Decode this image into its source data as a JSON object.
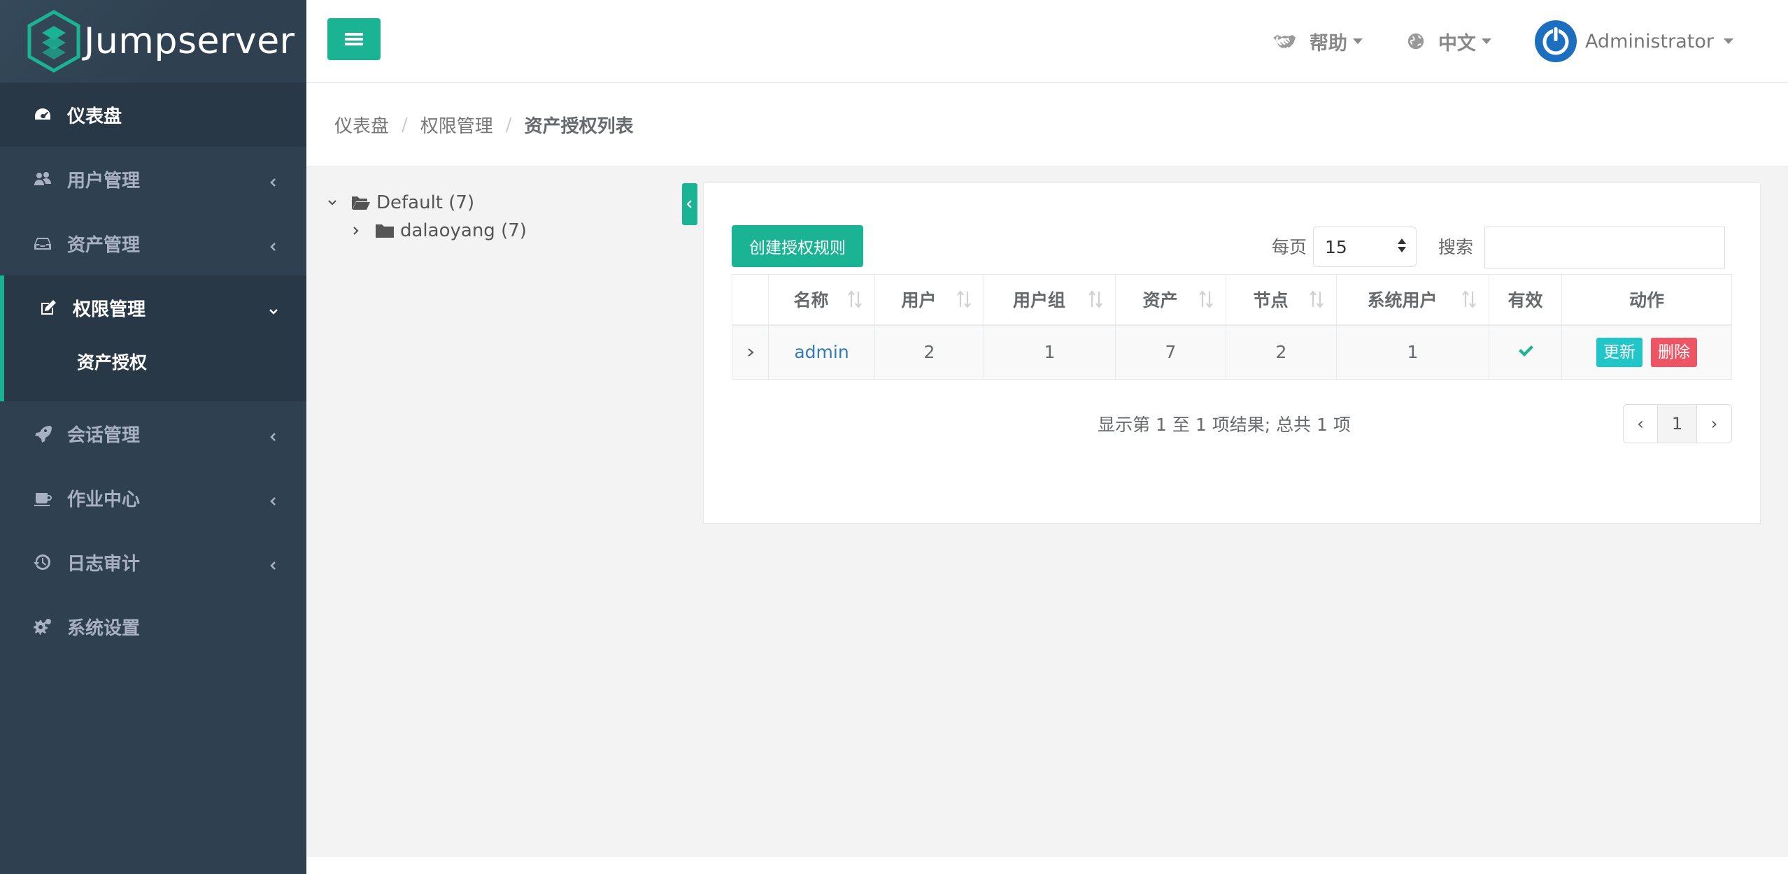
{
  "app": {
    "name": "Jumpserver"
  },
  "sidebar": {
    "items": [
      {
        "label": "仪表盘",
        "icon": "dashboard-icon"
      },
      {
        "label": "用户管理",
        "icon": "users-icon"
      },
      {
        "label": "资产管理",
        "icon": "inbox-icon"
      },
      {
        "label": "权限管理",
        "icon": "edit-icon",
        "sub": [
          "资产授权"
        ]
      },
      {
        "label": "会话管理",
        "icon": "rocket-icon"
      },
      {
        "label": "作业中心",
        "icon": "coffee-icon"
      },
      {
        "label": "日志审计",
        "icon": "history-icon"
      },
      {
        "label": "系统设置",
        "icon": "gears-icon"
      }
    ]
  },
  "topbar": {
    "help": "帮助",
    "language": "中文",
    "user": "Administrator"
  },
  "breadcrumb": [
    "仪表盘",
    "权限管理",
    "资产授权列表"
  ],
  "tree": {
    "root": "Default (7)",
    "child": "dalaoyang (7)"
  },
  "toolbar": {
    "create_label": "创建授权规则",
    "per_page_label": "每页",
    "per_page_value": "15",
    "search_label": "搜索",
    "search_value": ""
  },
  "table": {
    "headers": [
      "名称",
      "用户",
      "用户组",
      "资产",
      "节点",
      "系统用户",
      "有效",
      "动作"
    ],
    "rows": [
      {
        "name": "admin",
        "users": "2",
        "user_groups": "1",
        "assets": "7",
        "nodes": "2",
        "system_users": "1",
        "active": true,
        "actions": [
          "更新",
          "删除"
        ]
      }
    ]
  },
  "pagination": {
    "info": "显示第 1 至 1 项结果; 总共 1 项",
    "prev": "‹",
    "current": "1",
    "next": "›"
  },
  "colors": {
    "accent": "#1ab394",
    "sidebar": "#2f4050",
    "update": "#23c6c8",
    "delete": "#ed5565",
    "link": "#337ab7"
  }
}
